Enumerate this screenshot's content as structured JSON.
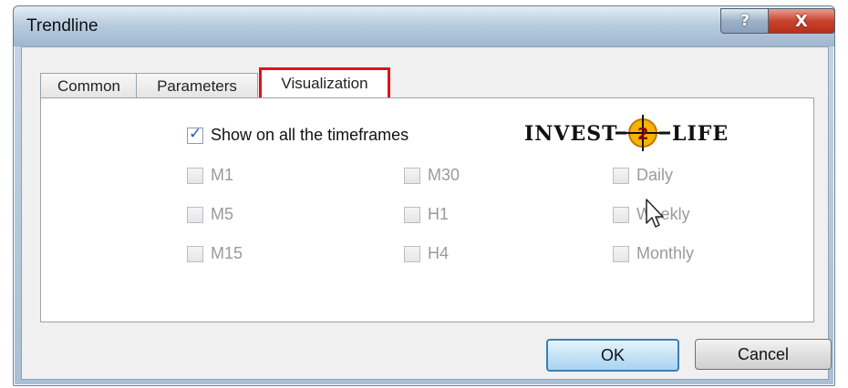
{
  "window": {
    "title": "Trendline",
    "help_glyph": "?",
    "close_glyph": "X"
  },
  "tabs": [
    {
      "label": "Common"
    },
    {
      "label": "Parameters"
    },
    {
      "label": "Visualization",
      "active": true
    }
  ],
  "show_all": {
    "label": "Show on all the timeframes",
    "checked": true
  },
  "timeframes": {
    "col1": [
      "M1",
      "M5",
      "M15"
    ],
    "col2": [
      "M30",
      "H1",
      "H4"
    ],
    "col3": [
      "Daily",
      "Weekly",
      "Monthly"
    ]
  },
  "logo_text": "INVEST 2 LIFE",
  "buttons": {
    "ok": "OK",
    "cancel": "Cancel"
  },
  "colors": {
    "accent_highlight": "#e0121b",
    "check": "#2459b7",
    "disabled_text": "#9a9a9a"
  },
  "icons": {
    "check": "checkmark-icon",
    "cursor": "mouse-pointer-icon",
    "logo": "invest2life-logo"
  }
}
